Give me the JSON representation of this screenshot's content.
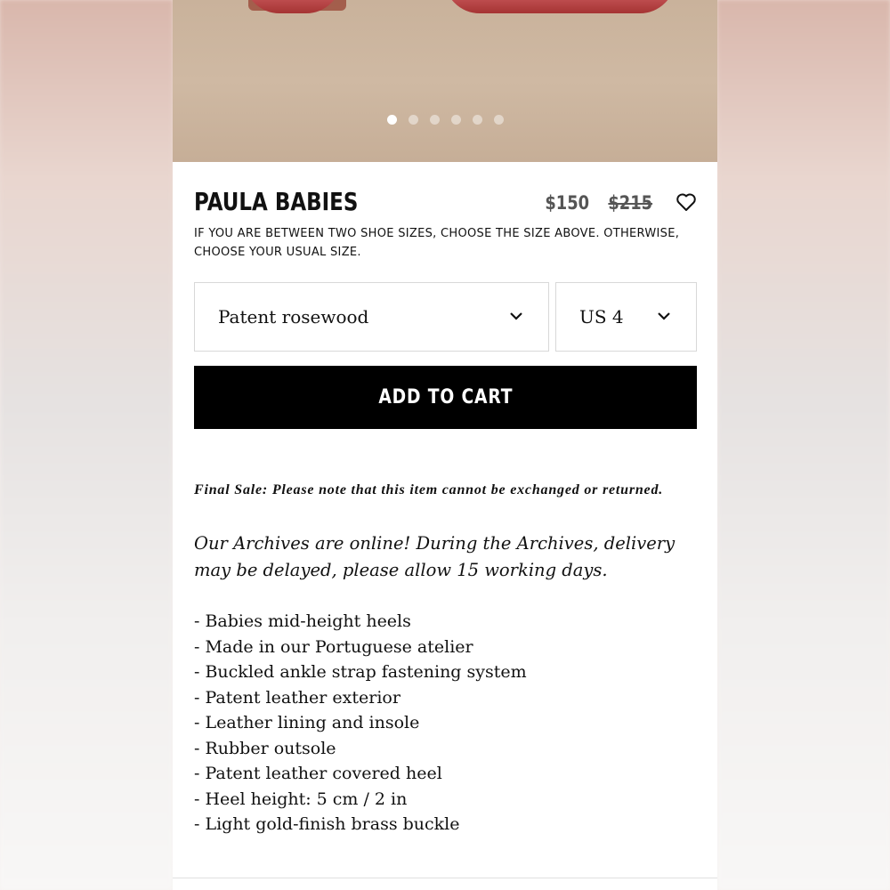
{
  "product": {
    "title": "PAULA BABIES",
    "price_sale": "$150",
    "price_original": "$215",
    "size_note": "IF YOU ARE BETWEEN TWO SHOE SIZES, CHOOSE THE SIZE ABOVE. OTHERWISE, CHOOSE YOUR USUAL SIZE."
  },
  "gallery": {
    "dot_count": 6,
    "active_index": 0
  },
  "selectors": {
    "color_value": "Patent rosewood",
    "size_value": "US 4"
  },
  "cart": {
    "button_label": "ADD TO CART"
  },
  "notes": {
    "final_sale": "Final Sale: Please note that this item cannot be exchanged or returned.",
    "archives": "Our Archives are online! During the Archives, delivery may be delayed, please allow 15 working days."
  },
  "features": [
    "- Babies mid-height heels",
    "- Made in our Portuguese atelier",
    "- Buckled ankle strap fastening system",
    "- Patent leather exterior",
    "- Leather lining and insole",
    "- Rubber outsole",
    "- Patent leather covered heel",
    "- Heel height: 5 cm / 2 in",
    "- Light gold-finish brass buckle"
  ],
  "icons": {
    "favorite": "heart-icon",
    "dropdown": "chevron-down-icon"
  },
  "colors": {
    "button_bg": "#000000",
    "button_text": "#ffffff",
    "price": "#555555"
  }
}
